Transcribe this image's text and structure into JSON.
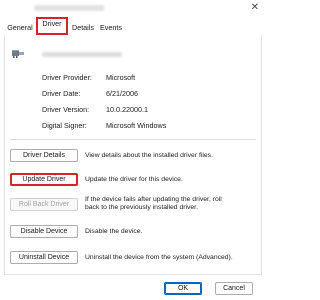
{
  "tabs": [
    "General",
    "Driver",
    "Details",
    "Events"
  ],
  "active_tab": "Driver",
  "device_icon": "network-adapter-icon",
  "properties": [
    {
      "label": "Driver Provider:",
      "value": "Microsoft"
    },
    {
      "label": "Driver Date:",
      "value": "6/21/2006"
    },
    {
      "label": "Driver Version:",
      "value": "10.0.22000.1"
    },
    {
      "label": "Digital Signer:",
      "value": "Microsoft Windows"
    }
  ],
  "actions": [
    {
      "label": "Driver Details",
      "description": "View details about the installed driver files.",
      "enabled": true,
      "highlighted": false
    },
    {
      "label": "Update Driver",
      "description": "Update the driver for this device.",
      "enabled": true,
      "highlighted": true
    },
    {
      "label": "Roll Back Driver",
      "description_line1": "If the device fails after updating the driver, roll",
      "description_line2": "back to the previously installed driver.",
      "enabled": false,
      "highlighted": false
    },
    {
      "label": "Disable Device",
      "description": "Disable the device.",
      "enabled": true,
      "highlighted": false
    },
    {
      "label": "Uninstall Device",
      "description": "Uninstall the device from the system (Advanced).",
      "enabled": true,
      "highlighted": false
    }
  ],
  "footer": {
    "ok_label": "OK",
    "cancel_label": "Cancel"
  },
  "colors": {
    "highlight": "#d42426",
    "primary": "#0067c0"
  }
}
